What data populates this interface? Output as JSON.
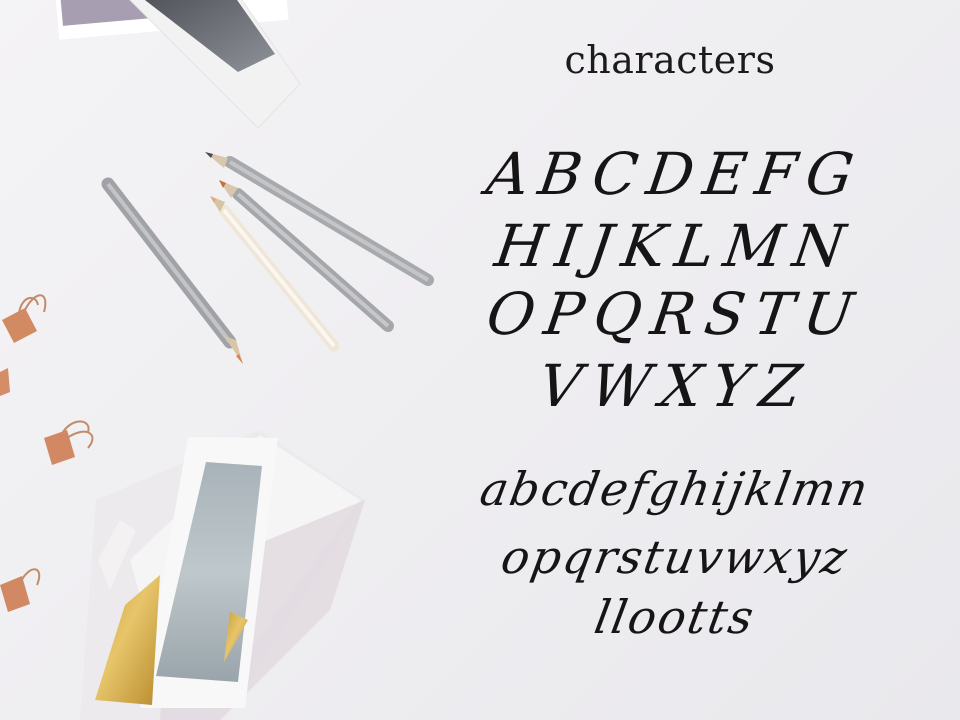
{
  "title": "characters",
  "uppercase_rows": [
    "ABCDEFG",
    "HIJKLMN",
    "OPQRSTU",
    "VWXYZ"
  ],
  "lowercase_rows": [
    "abcdefghijklmn",
    "opqrstuvwxyz",
    "llootts"
  ],
  "objects": {
    "pencils": "pencil",
    "binder_clips": "binder-clip",
    "watercolor_cards": "watercolor-card"
  }
}
